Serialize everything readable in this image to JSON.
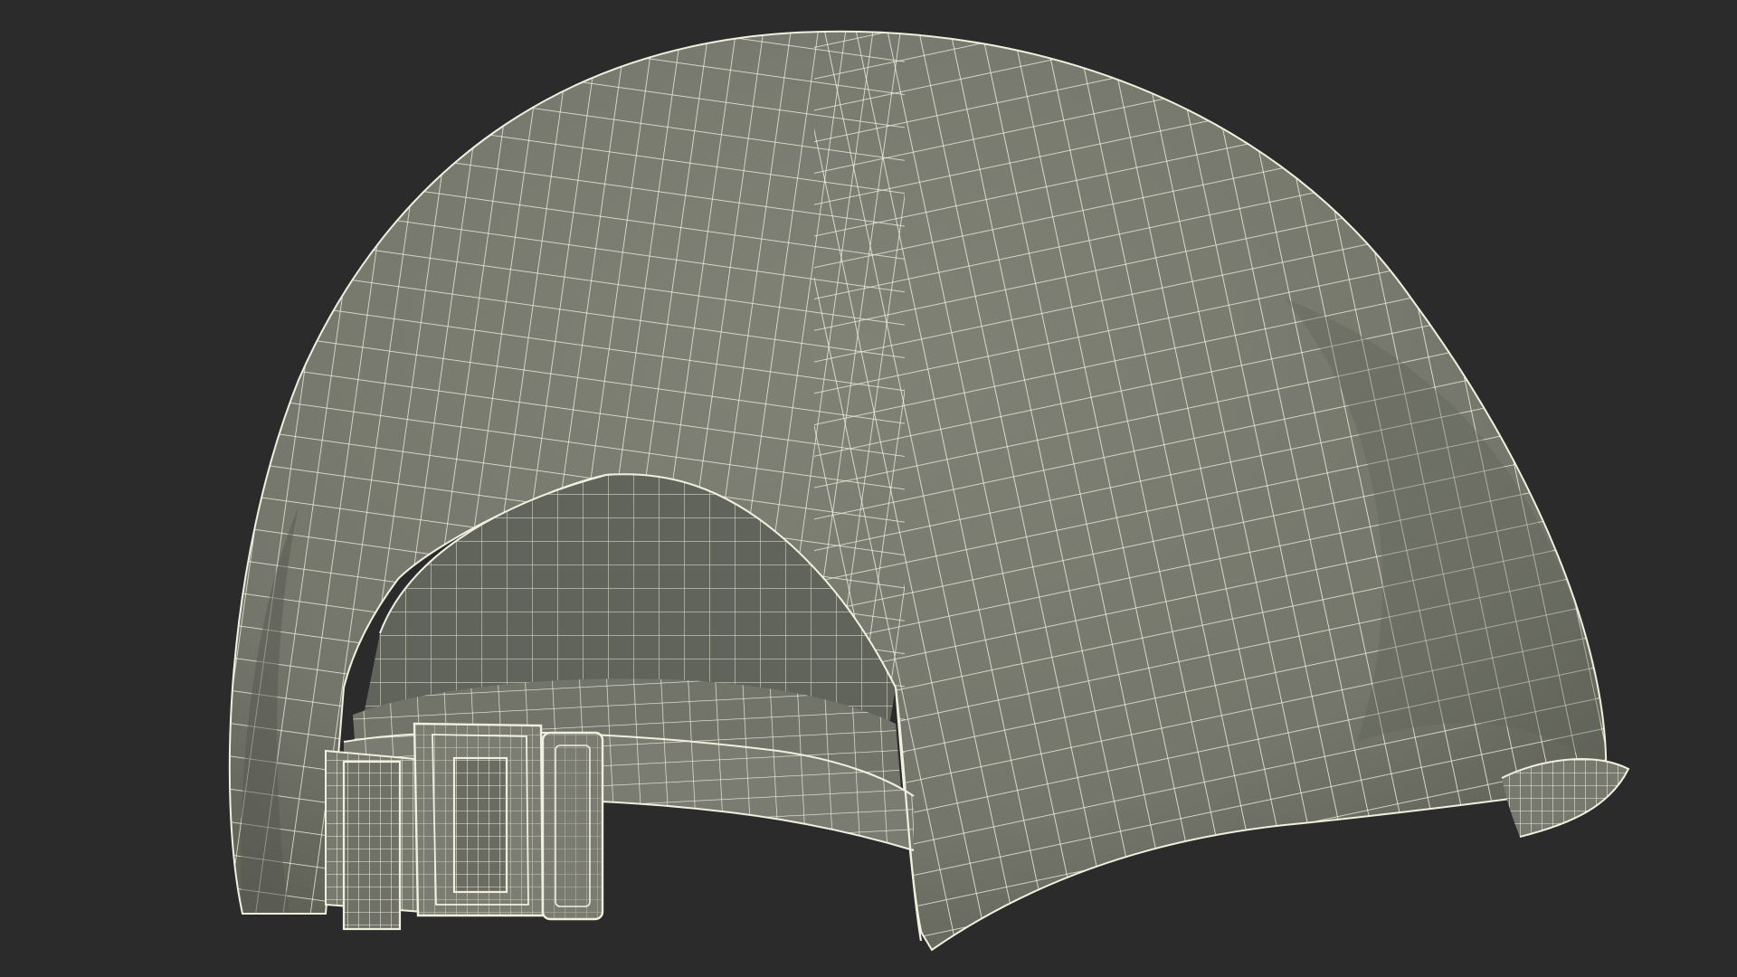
{
  "scene": {
    "subject_icon": "cap-wireframe-icon",
    "colors": {
      "background": "#2b2b2b",
      "cap_shell": "#7c7e72",
      "cap_shadow": "#5f6157",
      "cap_inner": "#6a6c62",
      "inner_dark": "#55574f",
      "wire": "#f1f0de"
    }
  }
}
